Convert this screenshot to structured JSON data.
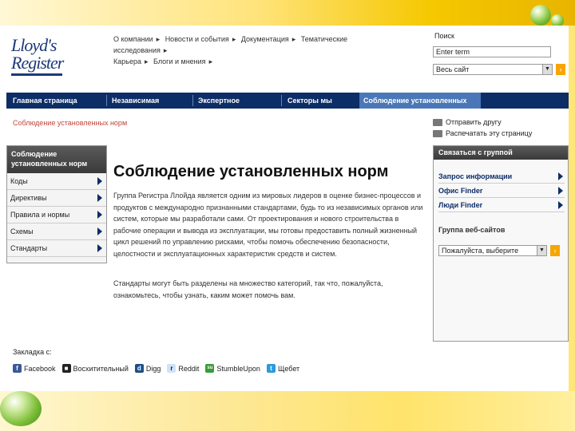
{
  "logo": {
    "line1": "Lloyd's",
    "line2": "Register"
  },
  "top_links": {
    "row1": [
      "О компании",
      "Новости и события",
      "Документация",
      "Тематические исследования"
    ],
    "row2": [
      "Карьера",
      "Блоги и мнения"
    ]
  },
  "search": {
    "label": "Поиск",
    "input_value": "Enter term",
    "scope_value": "Весь сайт",
    "go_label": "›"
  },
  "nav": {
    "items": [
      "Главная страница",
      "Независимая проверка",
      "Экспертное заключение",
      "Секторы мы служим",
      "Соблюдение установленных норм"
    ],
    "active_index": 4
  },
  "breadcrumb": "Соблюдение установленных норм",
  "tools": {
    "send": "Отправить другу",
    "print": "Распечатать эту страницу"
  },
  "leftnav": {
    "header": "Соблюдение установленных норм",
    "items": [
      "Коды",
      "Директивы",
      "Правила и нормы",
      "Схемы",
      "Стандарты"
    ]
  },
  "main": {
    "title": "Соблюдение установленных норм",
    "para1": "Группа Регистра Ллойда является одним из мировых лидеров в оценке бизнес-процессов и продуктов с международно признанными стандартами, будь то из независимых органов или систем, которые мы разработали сами. От проектирования и нового строительства в рабочие операции и вывода из эксплуатации, мы готовы предоставить полный жизненный цикл решений по управлению рисками, чтобы помочь обеспечению безопасности, целостности и эксплуатационных характеристик средств и систем.",
    "para2": "Стандарты могут быть разделены на множество категорий, так что, пожалуйста, ознакомьтесь, чтобы узнать, каким может помочь вам."
  },
  "contact": {
    "header": "Связаться с группой",
    "links": [
      "Запрос информации",
      "Офис Finder",
      "Люди Finder"
    ],
    "sites_label": "Группа веб-сайтов",
    "select_value": "Пожалуйста, выберите",
    "go_label": "›"
  },
  "bookmarks": {
    "label": "Закладка с:",
    "items": [
      {
        "name": "Facebook",
        "icon": "facebook-icon",
        "color": "#3b5998",
        "glyph": "f"
      },
      {
        "name": "Восхитительный",
        "icon": "delicious-icon",
        "color": "#222222",
        "glyph": "■"
      },
      {
        "name": "Digg",
        "icon": "digg-icon",
        "color": "#1d4f88",
        "glyph": "d"
      },
      {
        "name": "Reddit",
        "icon": "reddit-icon",
        "color": "#cee3f8",
        "glyph": "r"
      },
      {
        "name": "StumbleUpon",
        "icon": "stumbleupon-icon",
        "color": "#3a9b3a",
        "glyph": "su"
      },
      {
        "name": "Щебет",
        "icon": "twitter-icon",
        "color": "#2b9be0",
        "glyph": "t"
      }
    ]
  }
}
